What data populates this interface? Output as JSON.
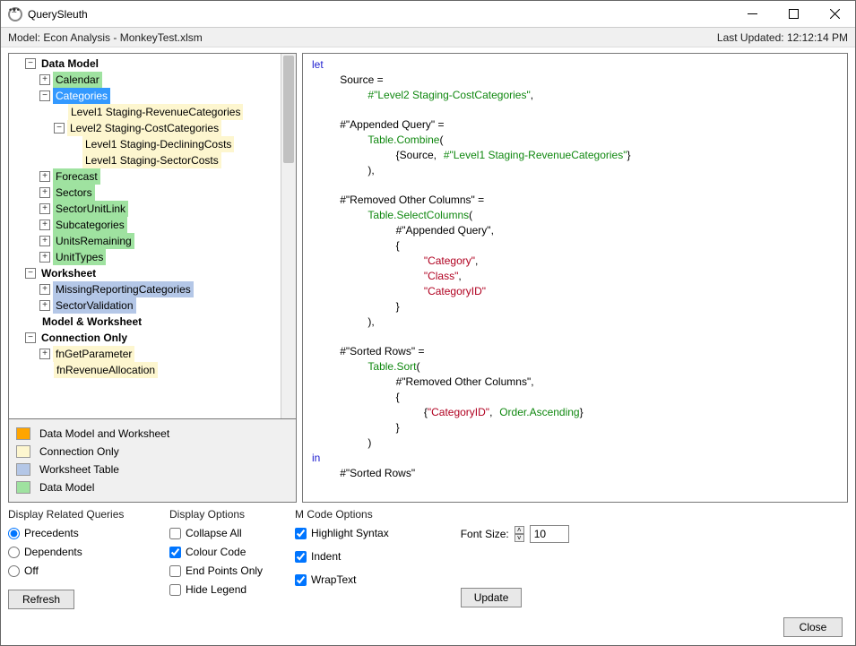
{
  "app_title": "QuerySleuth",
  "model_label": "Model: Econ Analysis - MonkeyTest.xlsm",
  "last_updated": "Last Updated: 12:12:14 PM",
  "tree": {
    "data_model": "Data Model",
    "calendar": "Calendar",
    "categories": "Categories",
    "lvl1_revcat": "Level1 Staging-RevenueCategories",
    "lvl2_costcat": "Level2 Staging-CostCategories",
    "lvl1_declining": "Level1 Staging-DecliningCosts",
    "lvl1_sectorcosts": "Level1 Staging-SectorCosts",
    "forecast": "Forecast",
    "sectors": "Sectors",
    "sectorunitlink": "SectorUnitLink",
    "subcategories": "Subcategories",
    "unitsremaining": "UnitsRemaining",
    "unittypes": "UnitTypes",
    "worksheet": "Worksheet",
    "missing_reporting": "MissingReportingCategories",
    "sector_validation": "SectorValidation",
    "model_worksheet": "Model & Worksheet",
    "connection_only": "Connection Only",
    "fngetparameter": "fnGetParameter",
    "fnrevenuealloc": "fnRevenueAllocation"
  },
  "legend": {
    "dm_ws": "Data Model and Worksheet",
    "conn_only": "Connection Only",
    "ws_table": "Worksheet Table",
    "dm": "Data Model"
  },
  "related": {
    "title": "Display Related Queries",
    "precedents": "Precedents",
    "dependents": "Dependents",
    "off": "Off",
    "refresh": "Refresh"
  },
  "display": {
    "title": "Display Options",
    "collapse": "Collapse All",
    "colour": "Colour Code",
    "endpoints": "End Points Only",
    "hidelegend": "Hide Legend"
  },
  "mcode": {
    "title": "M Code Options",
    "highlight": "Highlight Syntax",
    "indent": "Indent",
    "wrap": "WrapText",
    "fontsize_label": "Font Size:",
    "fontsize_value": "10",
    "update": "Update"
  },
  "footer": {
    "close": "Close"
  },
  "code": {
    "let": "let",
    "source_lhs": "Source =",
    "source_rhs": "#\"Level2 Staging-CostCategories\"",
    "comma": ",",
    "app_lhs": "#\"Appended Query\" =",
    "table_combine": "Table.Combine",
    "open_paren": "(",
    "close_paren": ")",
    "open_brace": "{",
    "close_brace": "}",
    "source_ref": "Source",
    "lvl1_ref": "#\"Level1 Staging-RevenueCategories\"",
    "removed_lhs": "#\"Removed Other Columns\" =",
    "table_select": "Table.SelectColumns",
    "appended_ref": "#\"Appended Query\"",
    "col_category": "\"Category\"",
    "col_class": "\"Class\"",
    "col_catid": "\"CategoryID\"",
    "sorted_lhs": "#\"Sorted Rows\" =",
    "table_sort": "Table.Sort",
    "removed_ref": "#\"Removed Other Columns\"",
    "order_asc": "Order.Ascending",
    "in": "in",
    "sorted_ref": "#\"Sorted Rows\""
  }
}
